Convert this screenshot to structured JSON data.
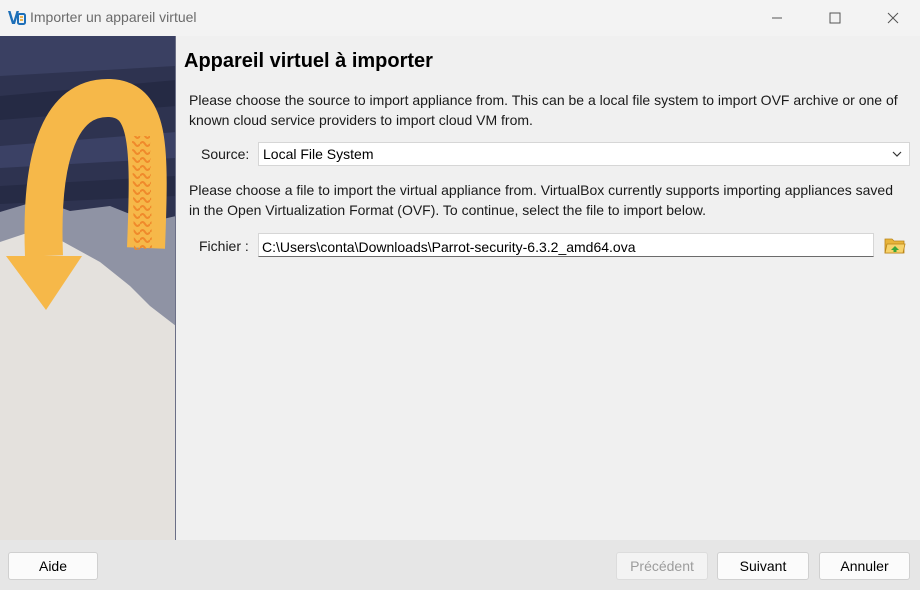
{
  "window": {
    "title": "Importer un appareil virtuel",
    "minimize_icon": "minimize-icon",
    "maximize_icon": "maximize-icon",
    "close_icon": "close-icon"
  },
  "main": {
    "heading": "Appareil virtuel à importer",
    "source_description": "Please choose the source to import appliance from. This can be a local file system to import OVF archive or one of known cloud service providers to import cloud VM from.",
    "source_label": "Source:",
    "source_value": "Local File System",
    "file_description": "Please choose a file to import the virtual appliance from. VirtualBox currently supports importing appliances saved in the Open Virtualization Format (OVF). To continue, select the file to import below.",
    "file_label": "Fichier :",
    "file_value": "C:\\Users\\conta\\Downloads\\Parrot-security-6.3.2_amd64.ova",
    "browse_icon": "folder-open-icon"
  },
  "footer": {
    "help_label": "Aide",
    "back_label": "Précédent",
    "next_label": "Suivant",
    "cancel_label": "Annuler"
  },
  "colors": {
    "arrow": "#f6b849",
    "arrow_pattern": "#f08a2b",
    "banner_dark": "#2e3350",
    "banner_light": "#e4e1dd"
  }
}
